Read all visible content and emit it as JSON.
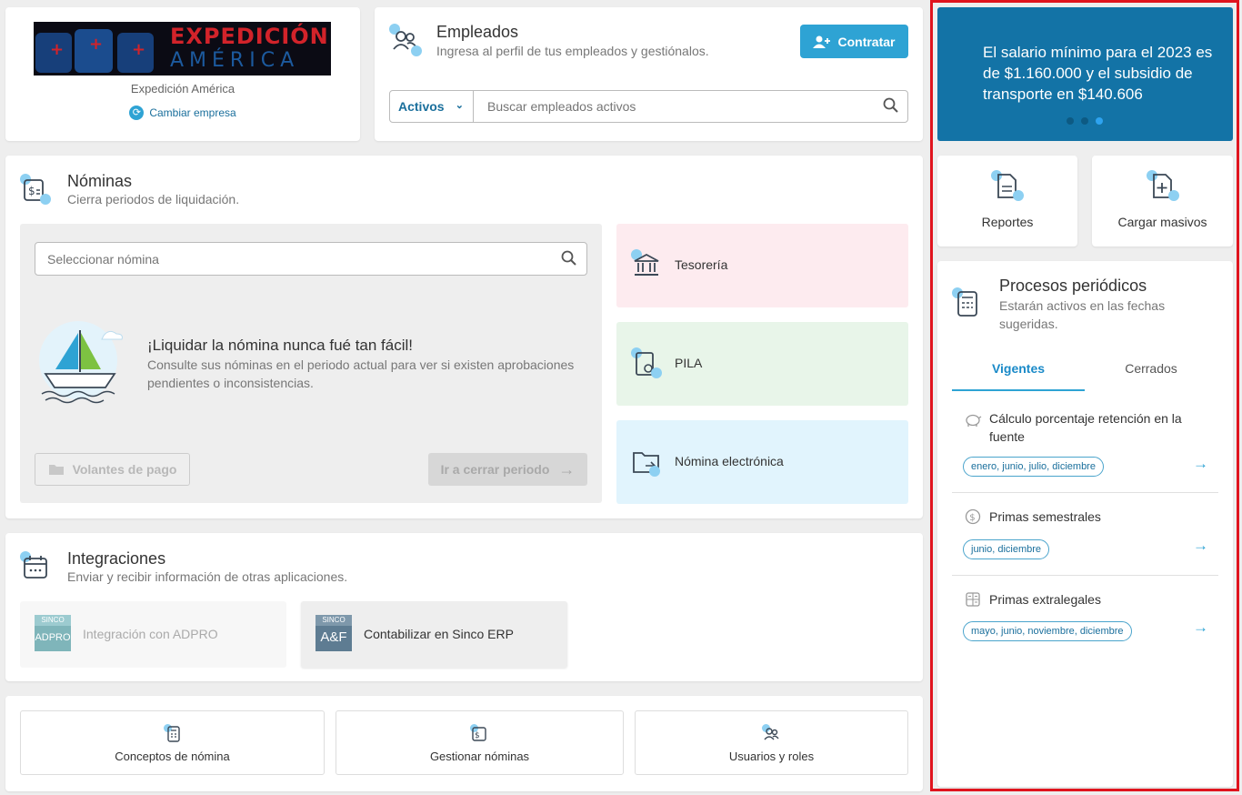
{
  "company": {
    "logo_line1": "EXPEDICIÓN",
    "logo_line2": "AMÉRICA",
    "name": "Expedición América",
    "change_label": "Cambiar empresa"
  },
  "employees": {
    "title": "Empleados",
    "subtitle": "Ingresa al perfil de tus empleados y gestiónalos.",
    "hire_label": "Contratar",
    "filter_value": "Activos",
    "search_placeholder": "Buscar empleados activos"
  },
  "payroll": {
    "title": "Nóminas",
    "subtitle": "Cierra periodos de liquidación.",
    "select_placeholder": "Seleccionar nómina",
    "headline": "¡Liquidar la nómina nunca fué tan fácil!",
    "description": "Consulte sus nóminas en el periodo actual para ver si existen aprobaciones pendientes o inconsistencias.",
    "payslips_label": "Volantes de pago",
    "close_period_label": "Ir a cerrar periodo",
    "side_items": [
      {
        "label": "Tesorería",
        "color": "#fdebef"
      },
      {
        "label": "PILA",
        "color": "#e8f5e9"
      },
      {
        "label": "Nómina electrónica",
        "color": "#e1f4fd"
      }
    ]
  },
  "integrations": {
    "title": "Integraciones",
    "subtitle": "Enviar y recibir información de otras aplicaciones.",
    "items": [
      {
        "badge_top": "SINCO",
        "badge_main": "ADPRO",
        "label": "Integración con ADPRO"
      },
      {
        "badge_top": "SINCO",
        "badge_main": "A&F",
        "label": "Contabilizar en Sinco ERP"
      }
    ]
  },
  "shortcuts": [
    {
      "label": "Conceptos de nómina",
      "icon": "calculator-icon"
    },
    {
      "label": "Gestionar nóminas",
      "icon": "payroll-doc-icon"
    },
    {
      "label": "Usuarios y roles",
      "icon": "users-icon"
    }
  ],
  "banner": {
    "text": "El salario mínimo para el 2023 es de $1.160.000 y el subsidio de transporte en $140.606",
    "dots_active": 3,
    "dots_total": 3,
    "color": "#1373a6"
  },
  "quick_actions": [
    {
      "label": "Reportes",
      "icon": "report-icon"
    },
    {
      "label": "Cargar masivos",
      "icon": "upload-file-icon"
    }
  ],
  "processes": {
    "title": "Procesos periódicos",
    "subtitle": "Estarán activos en las fechas sugeridas.",
    "tabs": [
      {
        "label": "Vigentes",
        "active": true
      },
      {
        "label": "Cerrados",
        "active": false
      }
    ],
    "items": [
      {
        "label": "Cálculo porcentaje retención en la fuente",
        "months": "enero, junio, julio, diciembre",
        "icon": "piggy-bank-icon"
      },
      {
        "label": "Primas semestrales",
        "months": "junio, diciembre",
        "icon": "dollar-circle-icon"
      },
      {
        "label": "Primas extralegales",
        "months": "mayo, junio, noviembre, diciembre",
        "icon": "calculator-icon"
      }
    ]
  },
  "colors": {
    "accent": "#2ea3d4",
    "highlight_border": "#e0141e",
    "icon_blob": "#8dd0f2"
  }
}
